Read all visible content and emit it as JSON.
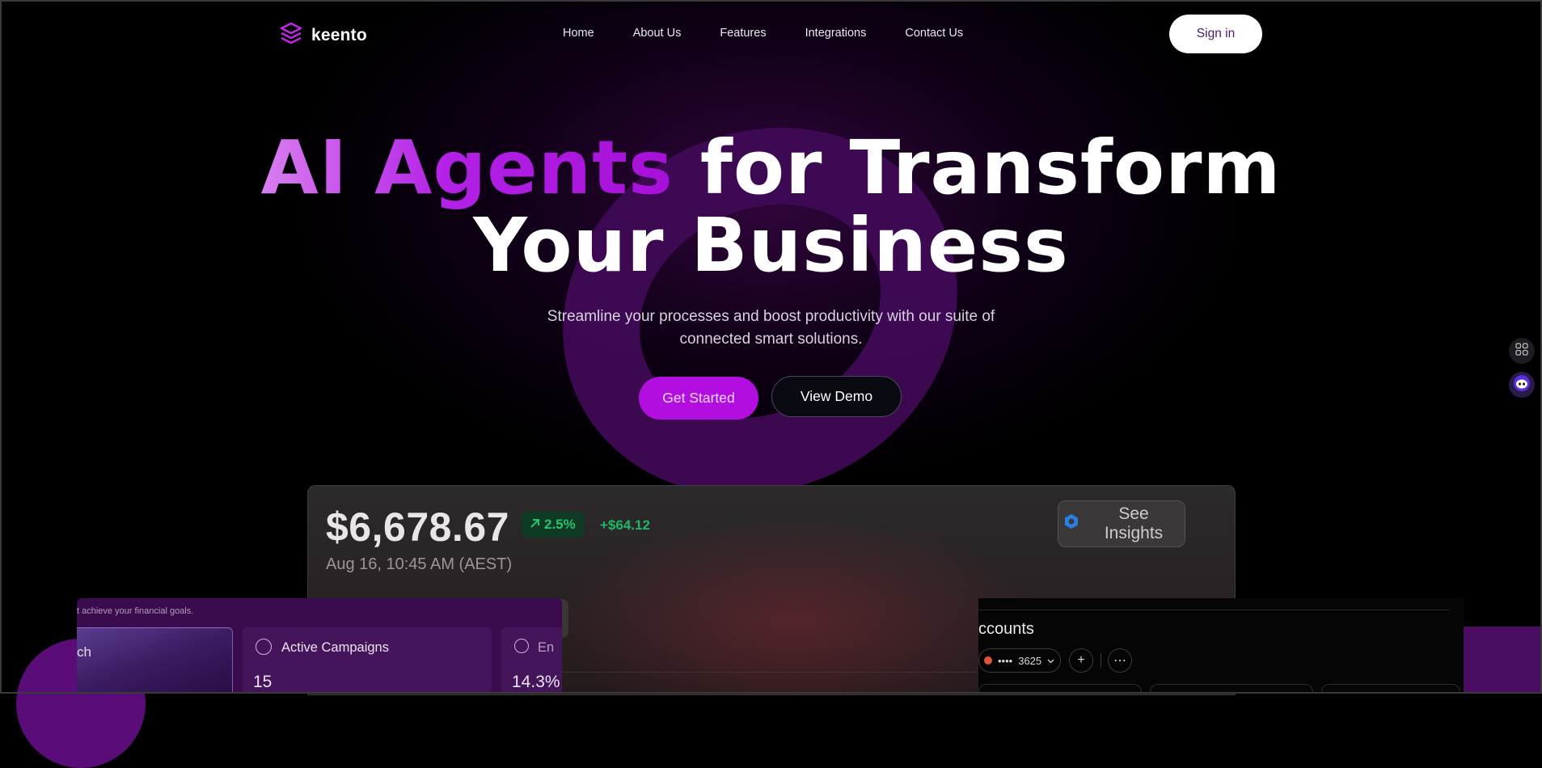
{
  "brand": {
    "name": "keento",
    "accent": "#b20ee0"
  },
  "nav": {
    "items": [
      "Home",
      "About Us",
      "Features",
      "Integrations",
      "Contact Us"
    ],
    "signin_label": "Sign in"
  },
  "hero": {
    "title_highlight": "AI Agents",
    "title_rest": " for Transform",
    "title_line2": "Your Business",
    "subtitle_line1": "Streamline your processes and boost productivity with our suite of",
    "subtitle_line2": "connected smart solutions.",
    "primary_cta": "Get Started",
    "secondary_cta": "View Demo"
  },
  "dashboard": {
    "amount": "$6,678.67",
    "change_pct": "2.5%",
    "change_value": "+$64.12",
    "timestamp": "Aug 16, 10:45 AM (AEST)",
    "insights_label": "See Insights"
  },
  "left_card": {
    "tagline": "t achieve your financial goals.",
    "tile_a_label": "ch",
    "tile_b_label": "Active Campaigns",
    "tile_b_value": "15",
    "tile_c_label": "En",
    "tile_c_value": "14.3%"
  },
  "right_card": {
    "title": "ccounts",
    "account_mask": "••••",
    "account_last4": "3625"
  }
}
